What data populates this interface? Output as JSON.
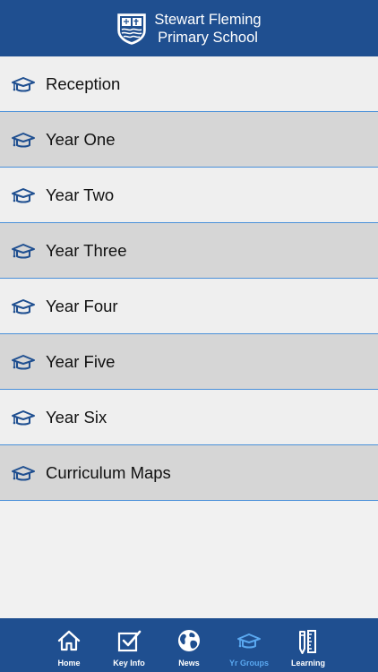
{
  "header": {
    "school_line1": "Stewart Fleming",
    "school_line2": "Primary School",
    "crest_icon": "school-crest-icon"
  },
  "list": {
    "icon": "graduation-cap-icon",
    "accent_color": "#4a90d9",
    "items": [
      {
        "label": "Reception"
      },
      {
        "label": "Year One"
      },
      {
        "label": "Year Two"
      },
      {
        "label": "Year Three"
      },
      {
        "label": "Year Four"
      },
      {
        "label": "Year Five"
      },
      {
        "label": "Year Six"
      },
      {
        "label": "Curriculum Maps"
      }
    ]
  },
  "tabbar": {
    "background": "#1f4f90",
    "active_color": "#5aa8f0",
    "tabs": [
      {
        "label": "Home",
        "icon": "home-icon"
      },
      {
        "label": "Key Info",
        "icon": "checkbox-icon"
      },
      {
        "label": "News",
        "icon": "globe-icon"
      },
      {
        "label": "Yr Groups",
        "icon": "graduation-cap-icon",
        "active": true
      },
      {
        "label": "Learning",
        "icon": "pencil-ruler-icon"
      }
    ]
  }
}
